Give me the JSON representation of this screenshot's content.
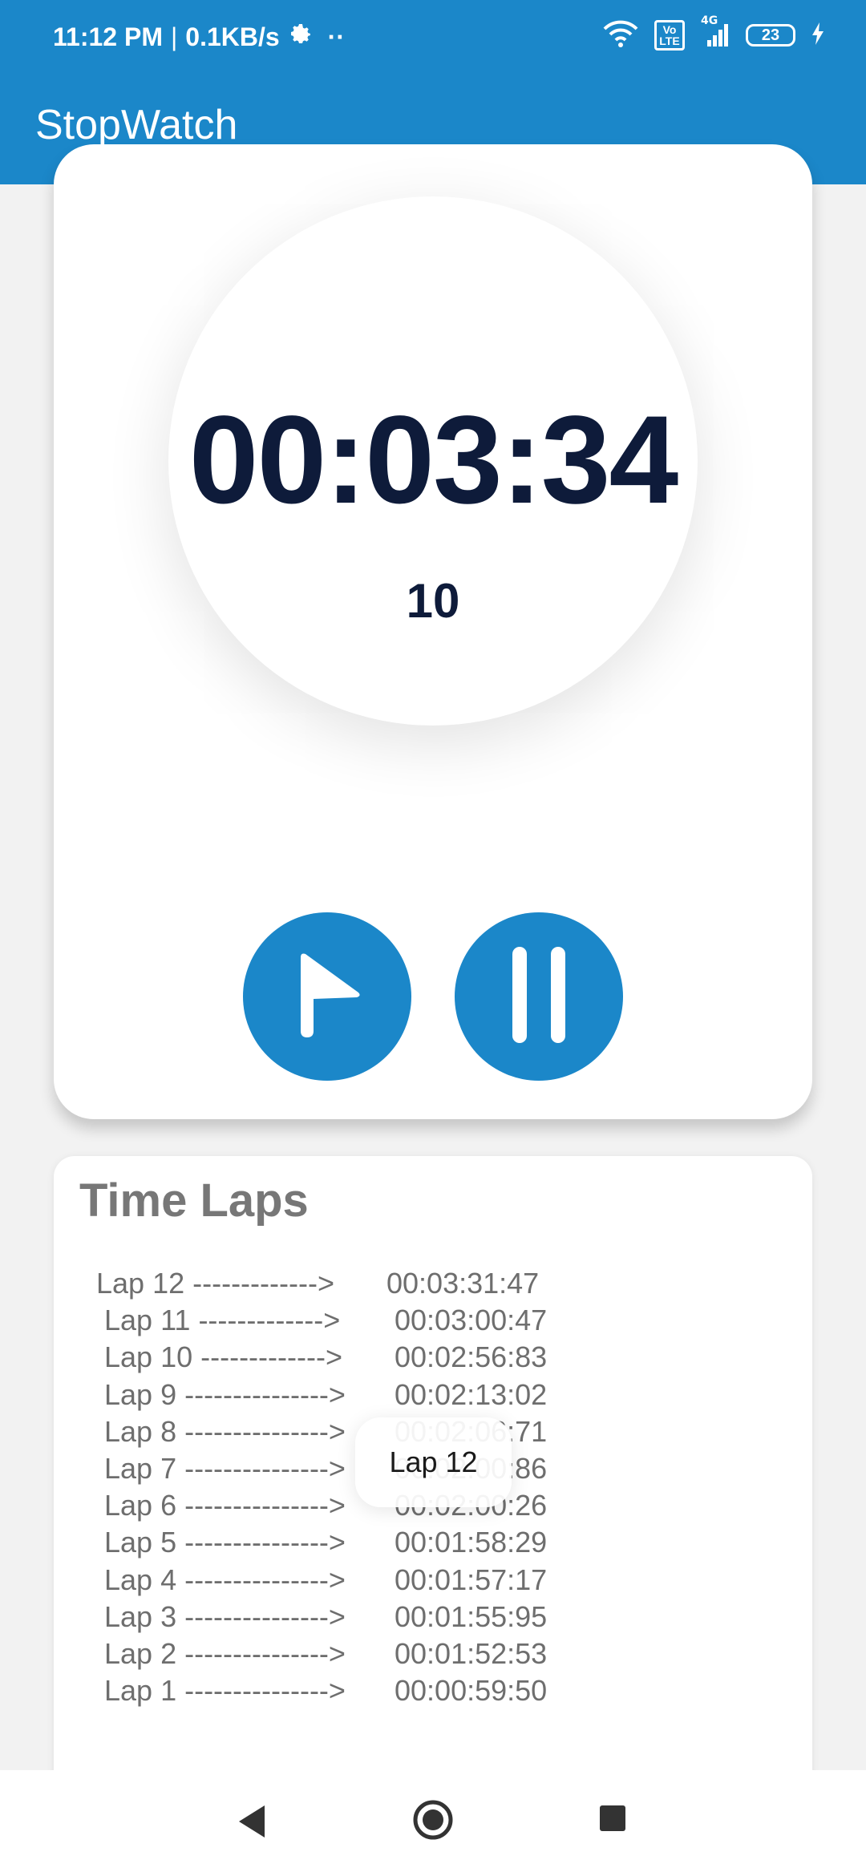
{
  "status_bar": {
    "time": "11:12 PM",
    "separator": "|",
    "net_speed": "0.1KB/s",
    "more": "··",
    "battery": "23",
    "network_type": "4G",
    "volte": "Vo LTE"
  },
  "app_bar": {
    "title": "StopWatch"
  },
  "timer": {
    "time": "00:03:34",
    "centis": "10"
  },
  "controls": {
    "lap_button": "flag-icon",
    "pause_button": "pause-icon"
  },
  "laps": {
    "title": "Time Laps",
    "rows": [
      {
        "label": "Lap 12 ------------->",
        "time": "00:03:31:47"
      },
      {
        "label": "Lap 11 ------------->",
        "time": "00:03:00:47"
      },
      {
        "label": "Lap 10 ------------->",
        "time": "00:02:56:83"
      },
      {
        "label": "Lap 9 --------------->",
        "time": "00:02:13:02"
      },
      {
        "label": "Lap 8 --------------->",
        "time": "00:02:06:71"
      },
      {
        "label": "Lap 7 --------------->",
        "time": "00:02:00:86"
      },
      {
        "label": "Lap 6 --------------->",
        "time": "00:02:00:26"
      },
      {
        "label": "Lap 5 --------------->",
        "time": "00:01:58:29"
      },
      {
        "label": "Lap 4 --------------->",
        "time": "00:01:57:17"
      },
      {
        "label": "Lap 3 --------------->",
        "time": "00:01:55:95"
      },
      {
        "label": "Lap 2 --------------->",
        "time": "00:01:52:53"
      },
      {
        "label": "Lap 1 --------------->",
        "time": "00:00:59:50"
      }
    ]
  },
  "toast": {
    "text": "Lap 12"
  },
  "colors": {
    "primary": "#1b87c9",
    "clock_text": "#0e1b3a",
    "lap_text": "#6e6e6e"
  }
}
